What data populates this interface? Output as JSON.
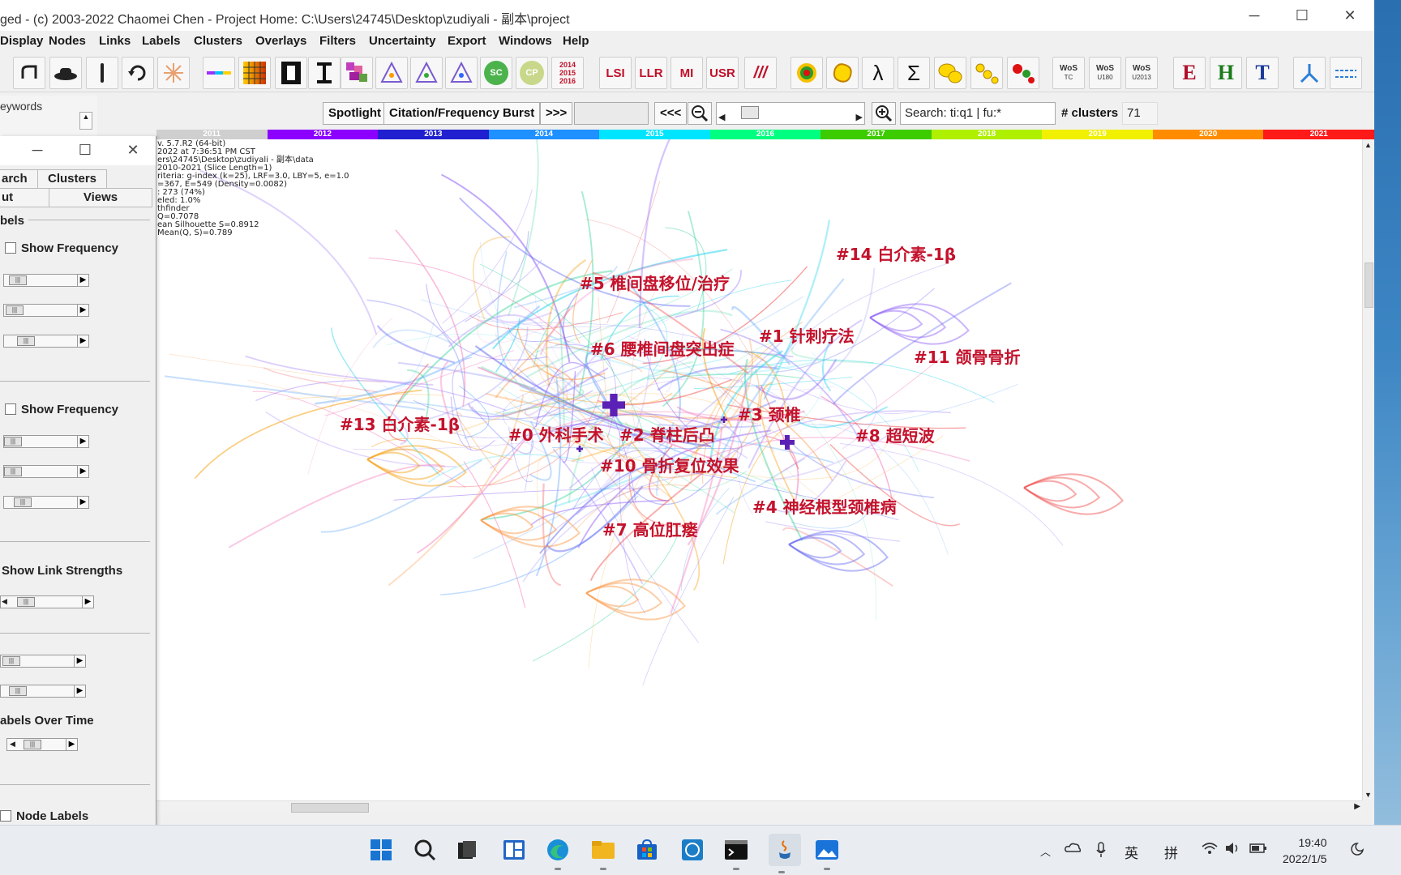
{
  "window": {
    "title": "ged - (c) 2003-2022 Chaomei Chen - Project Home: C:\\Users\\24745\\Desktop\\zudiyali - 副本\\project",
    "minimize": "─",
    "maximize": "☐",
    "close": "✕"
  },
  "menu": [
    "Display",
    "Nodes",
    "Links",
    "Labels",
    "Clusters",
    "Overlays",
    "Filters",
    "Uncertainty",
    "Export",
    "Windows",
    "Help"
  ],
  "toolbar": {
    "icons": [
      "reload-graph-icon",
      "hat-icon",
      "pin-icon",
      "refresh-icon",
      "spark-icon",
      "color-line-icon",
      "grid-icon",
      "h-icon",
      "i-icon",
      "pixel-map-icon",
      "triangle-a-icon",
      "triangle-b-icon",
      "triangle-c-icon",
      "sc-icon",
      "cp-icon",
      "years-icon"
    ],
    "sc": "SC",
    "cp": "CP",
    "years": [
      "2014",
      "2015",
      "2016"
    ],
    "text_buttons": [
      "LSI",
      "LLR",
      "MI",
      "USR",
      "///"
    ],
    "shape_icons": [
      "ring-icon",
      "blob-icon",
      "lambda-icon",
      "sigma-icon",
      "yellow-blobs-icon",
      "chain-icon",
      "dots-icon"
    ],
    "lambda": "λ",
    "sigma": "Σ",
    "wos": [
      {
        "main": "WoS",
        "sub": "TC"
      },
      {
        "main": "WoS",
        "sub": "U180"
      },
      {
        "main": "WoS",
        "sub": "U2013"
      }
    ],
    "letters": [
      "E",
      "H",
      "T"
    ]
  },
  "controls": {
    "spotlight": "Spotlight",
    "burst": "Citation/Frequency Burst",
    "next": ">>>",
    "prev": "<<<",
    "search_value": "Search: ti:q1 | fu:*",
    "clusters_label": "# clusters",
    "clusters_value": "71"
  },
  "timeline": {
    "years": [
      "2011",
      "2012",
      "2013",
      "2014",
      "2015",
      "2016",
      "2017",
      "2018",
      "2019",
      "2020",
      "2021"
    ],
    "colors": [
      "#cfcfcf",
      "#8b00ff",
      "#2020d0",
      "#1e90ff",
      "#00e5ff",
      "#00ff80",
      "#3ccc00",
      "#aef000",
      "#f0f000",
      "#ff8c00",
      "#ff1a1a"
    ]
  },
  "info_lines": [
    "v. 5.7.R2 (64-bit)",
    "2022 at 7:36:51 PM CST",
    "ers\\24745\\Desktop\\zudiyali - 副本\\data",
    "2010-2021 (Slice Length=1)",
    "riteria: g-index (k=25), LRF=3.0, LBY=5, e=1.0",
    "=367, E=549 (Density=0.0082)",
    ": 273 (74%)",
    "eled: 1.0%",
    "thfinder",
    "Q=0.7078",
    "ean Silhouette S=0.8912",
    "Mean(Q, S)=0.789"
  ],
  "clusters": [
    {
      "label": "#14 白介素-1β"
    },
    {
      "label": "#5 椎间盘移位/治疗"
    },
    {
      "label": "#1 针刺疗法"
    },
    {
      "label": "#6 腰椎间盘突出症"
    },
    {
      "label": "#11 颌骨骨折"
    },
    {
      "label": "#3 颈椎"
    },
    {
      "label": "#13 白介素-1β"
    },
    {
      "label": "#0 外科手术"
    },
    {
      "label": "#2 脊柱后凸"
    },
    {
      "label": "#8 超短波"
    },
    {
      "label": "#10 骨折复位效果"
    },
    {
      "label": "#4 神经根型颈椎病"
    },
    {
      "label": "#7 高位肛瘘"
    }
  ],
  "side": {
    "keywords_label": "eywords",
    "tabs": [
      "arch",
      "Clusters",
      "ut",
      "Views"
    ],
    "section_labels": "bels",
    "show_frequency_1": "Show Frequency",
    "show_frequency_2": "Show Frequency",
    "show_link_strengths": "Show Link Strengths",
    "labels_over_time": "abels Over Time",
    "node_labels": "Node Labels",
    "minimize": "─",
    "maximize": "☐",
    "close": "✕"
  },
  "taskbar": {
    "apps": [
      "windows-start-icon",
      "search-icon",
      "file-explorer-icon",
      "snap-layout-icon",
      "edge-browser-icon",
      "folder-icon",
      "microsoft-store-icon",
      "dell-app-icon",
      "terminal-icon",
      "java-app-icon",
      "photos-icon"
    ],
    "tray": {
      "ime1": "英",
      "ime2": "拼"
    },
    "time": "19:40",
    "date": "2022/1/5"
  }
}
